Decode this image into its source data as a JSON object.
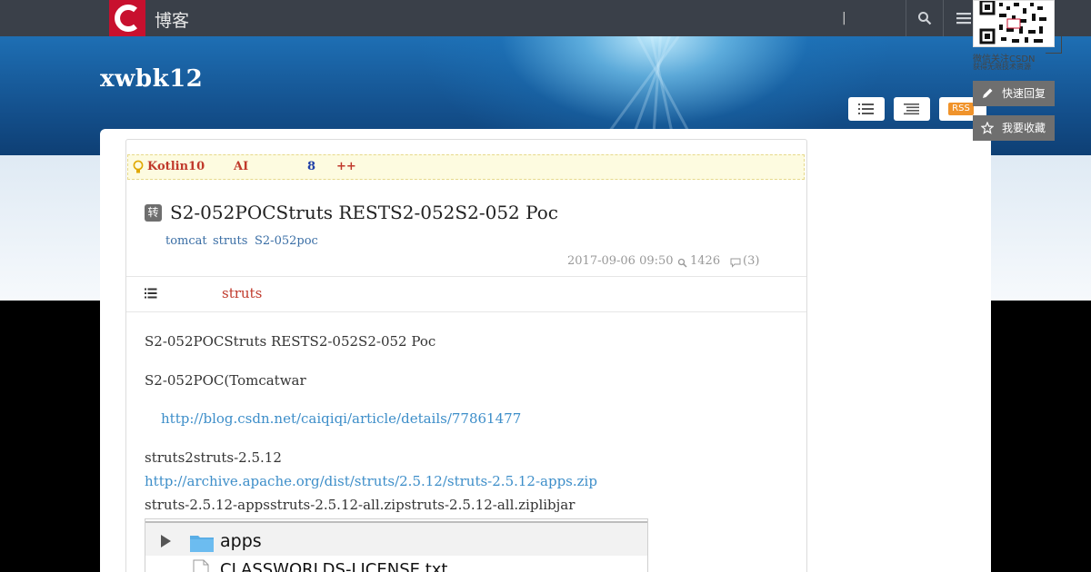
{
  "header": {
    "logo_letter": "C",
    "site_name": "博客",
    "separator": "|",
    "icons": [
      "search-icon",
      "menu-icon"
    ]
  },
  "banner": {
    "blog_title": "xwbk12",
    "rss_label": "RSS"
  },
  "sidebar_widgets": {
    "qr_caption": "微信关注CSDN",
    "qr_subcaption": "获得无限技术资源",
    "quick_reply": "快速回复",
    "favorite": "我要收藏"
  },
  "notice": {
    "items": [
      {
        "text": "Kotlin10",
        "color": "#c0392b"
      },
      {
        "text": "AI",
        "color": "#c0392b"
      },
      {
        "text": "8",
        "color": "#1f3fa8"
      },
      {
        "text": "++",
        "color": "#c0392b"
      }
    ]
  },
  "article": {
    "badge": "转",
    "title": "S2-052POCStruts RESTS2-052S2-052 Poc",
    "tags": [
      "tomcat",
      "struts",
      "S2-052poc"
    ],
    "date": "2017-09-06 09:50",
    "views": "1426",
    "comments": "(3)",
    "toc_link": "struts",
    "paragraphs": {
      "p1": "S2-052POCStruts RESTS2-052S2-052 Poc",
      "p2": "S2-052POC(Tomcatwar",
      "link1": "http://blog.csdn.net/caiqiqi/article/details/77861477",
      "p3": "struts2struts-2.5.12",
      "link2": "http://archive.apache.org/dist/struts/2.5.12/struts-2.5.12-apps.zip",
      "p4": "struts-2.5.12-appsstruts-2.5.12-all.zipstruts-2.5.12-all.ziplibjar"
    },
    "explorer": {
      "folder": "apps",
      "file": "CLASSWORLDS-LICENSE.txt"
    }
  }
}
